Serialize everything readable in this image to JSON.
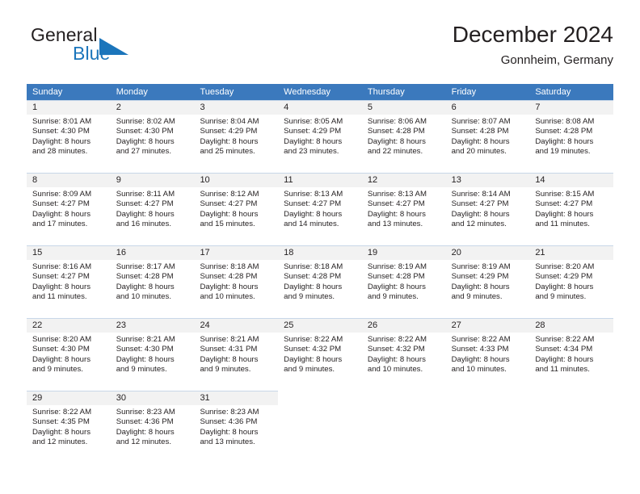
{
  "brand": {
    "word_one": "General",
    "word_two": "Blue",
    "flag_icon": "triangle-flag-icon",
    "color_dark": "#231f20",
    "color_blue": "#1b75bb"
  },
  "header": {
    "title": "December 2024",
    "subtitle": "Gonnheim, Germany"
  },
  "theme": {
    "header_bg": "#3b79bd",
    "header_text": "#ffffff",
    "daynum_bg": "#f2f2f2",
    "cell_border": "#c8d7e8",
    "text": "#231f20"
  },
  "weekdays": [
    "Sunday",
    "Monday",
    "Tuesday",
    "Wednesday",
    "Thursday",
    "Friday",
    "Saturday"
  ],
  "weeks": [
    [
      {
        "day": "1",
        "lines": [
          "Sunrise: 8:01 AM",
          "Sunset: 4:30 PM",
          "Daylight: 8 hours",
          "and 28 minutes."
        ]
      },
      {
        "day": "2",
        "lines": [
          "Sunrise: 8:02 AM",
          "Sunset: 4:30 PM",
          "Daylight: 8 hours",
          "and 27 minutes."
        ]
      },
      {
        "day": "3",
        "lines": [
          "Sunrise: 8:04 AM",
          "Sunset: 4:29 PM",
          "Daylight: 8 hours",
          "and 25 minutes."
        ]
      },
      {
        "day": "4",
        "lines": [
          "Sunrise: 8:05 AM",
          "Sunset: 4:29 PM",
          "Daylight: 8 hours",
          "and 23 minutes."
        ]
      },
      {
        "day": "5",
        "lines": [
          "Sunrise: 8:06 AM",
          "Sunset: 4:28 PM",
          "Daylight: 8 hours",
          "and 22 minutes."
        ]
      },
      {
        "day": "6",
        "lines": [
          "Sunrise: 8:07 AM",
          "Sunset: 4:28 PM",
          "Daylight: 8 hours",
          "and 20 minutes."
        ]
      },
      {
        "day": "7",
        "lines": [
          "Sunrise: 8:08 AM",
          "Sunset: 4:28 PM",
          "Daylight: 8 hours",
          "and 19 minutes."
        ]
      }
    ],
    [
      {
        "day": "8",
        "lines": [
          "Sunrise: 8:09 AM",
          "Sunset: 4:27 PM",
          "Daylight: 8 hours",
          "and 17 minutes."
        ]
      },
      {
        "day": "9",
        "lines": [
          "Sunrise: 8:11 AM",
          "Sunset: 4:27 PM",
          "Daylight: 8 hours",
          "and 16 minutes."
        ]
      },
      {
        "day": "10",
        "lines": [
          "Sunrise: 8:12 AM",
          "Sunset: 4:27 PM",
          "Daylight: 8 hours",
          "and 15 minutes."
        ]
      },
      {
        "day": "11",
        "lines": [
          "Sunrise: 8:13 AM",
          "Sunset: 4:27 PM",
          "Daylight: 8 hours",
          "and 14 minutes."
        ]
      },
      {
        "day": "12",
        "lines": [
          "Sunrise: 8:13 AM",
          "Sunset: 4:27 PM",
          "Daylight: 8 hours",
          "and 13 minutes."
        ]
      },
      {
        "day": "13",
        "lines": [
          "Sunrise: 8:14 AM",
          "Sunset: 4:27 PM",
          "Daylight: 8 hours",
          "and 12 minutes."
        ]
      },
      {
        "day": "14",
        "lines": [
          "Sunrise: 8:15 AM",
          "Sunset: 4:27 PM",
          "Daylight: 8 hours",
          "and 11 minutes."
        ]
      }
    ],
    [
      {
        "day": "15",
        "lines": [
          "Sunrise: 8:16 AM",
          "Sunset: 4:27 PM",
          "Daylight: 8 hours",
          "and 11 minutes."
        ]
      },
      {
        "day": "16",
        "lines": [
          "Sunrise: 8:17 AM",
          "Sunset: 4:28 PM",
          "Daylight: 8 hours",
          "and 10 minutes."
        ]
      },
      {
        "day": "17",
        "lines": [
          "Sunrise: 8:18 AM",
          "Sunset: 4:28 PM",
          "Daylight: 8 hours",
          "and 10 minutes."
        ]
      },
      {
        "day": "18",
        "lines": [
          "Sunrise: 8:18 AM",
          "Sunset: 4:28 PM",
          "Daylight: 8 hours",
          "and 9 minutes."
        ]
      },
      {
        "day": "19",
        "lines": [
          "Sunrise: 8:19 AM",
          "Sunset: 4:28 PM",
          "Daylight: 8 hours",
          "and 9 minutes."
        ]
      },
      {
        "day": "20",
        "lines": [
          "Sunrise: 8:19 AM",
          "Sunset: 4:29 PM",
          "Daylight: 8 hours",
          "and 9 minutes."
        ]
      },
      {
        "day": "21",
        "lines": [
          "Sunrise: 8:20 AM",
          "Sunset: 4:29 PM",
          "Daylight: 8 hours",
          "and 9 minutes."
        ]
      }
    ],
    [
      {
        "day": "22",
        "lines": [
          "Sunrise: 8:20 AM",
          "Sunset: 4:30 PM",
          "Daylight: 8 hours",
          "and 9 minutes."
        ]
      },
      {
        "day": "23",
        "lines": [
          "Sunrise: 8:21 AM",
          "Sunset: 4:30 PM",
          "Daylight: 8 hours",
          "and 9 minutes."
        ]
      },
      {
        "day": "24",
        "lines": [
          "Sunrise: 8:21 AM",
          "Sunset: 4:31 PM",
          "Daylight: 8 hours",
          "and 9 minutes."
        ]
      },
      {
        "day": "25",
        "lines": [
          "Sunrise: 8:22 AM",
          "Sunset: 4:32 PM",
          "Daylight: 8 hours",
          "and 9 minutes."
        ]
      },
      {
        "day": "26",
        "lines": [
          "Sunrise: 8:22 AM",
          "Sunset: 4:32 PM",
          "Daylight: 8 hours",
          "and 10 minutes."
        ]
      },
      {
        "day": "27",
        "lines": [
          "Sunrise: 8:22 AM",
          "Sunset: 4:33 PM",
          "Daylight: 8 hours",
          "and 10 minutes."
        ]
      },
      {
        "day": "28",
        "lines": [
          "Sunrise: 8:22 AM",
          "Sunset: 4:34 PM",
          "Daylight: 8 hours",
          "and 11 minutes."
        ]
      }
    ],
    [
      {
        "day": "29",
        "lines": [
          "Sunrise: 8:22 AM",
          "Sunset: 4:35 PM",
          "Daylight: 8 hours",
          "and 12 minutes."
        ]
      },
      {
        "day": "30",
        "lines": [
          "Sunrise: 8:23 AM",
          "Sunset: 4:36 PM",
          "Daylight: 8 hours",
          "and 12 minutes."
        ]
      },
      {
        "day": "31",
        "lines": [
          "Sunrise: 8:23 AM",
          "Sunset: 4:36 PM",
          "Daylight: 8 hours",
          "and 13 minutes."
        ]
      },
      {
        "day": "",
        "lines": []
      },
      {
        "day": "",
        "lines": []
      },
      {
        "day": "",
        "lines": []
      },
      {
        "day": "",
        "lines": []
      }
    ]
  ]
}
